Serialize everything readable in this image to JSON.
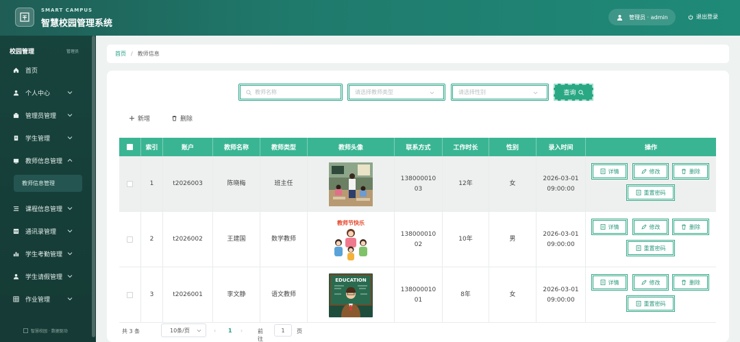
{
  "header": {
    "brand_en": "SMART CAMPUS",
    "brand_cn": "智慧校园管理系统",
    "user_label": "管理员 · admin",
    "logout_label": "退出登录"
  },
  "sidebar": {
    "title": "校园管理",
    "title_sub": "管理员",
    "items": [
      {
        "label": "首页",
        "icon": "home-icon"
      },
      {
        "label": "个人中心",
        "icon": "user-icon"
      },
      {
        "label": "管理员管理",
        "icon": "admin-icon"
      },
      {
        "label": "学生管理",
        "icon": "student-icon"
      },
      {
        "label": "教师信息管理",
        "icon": "teacher-icon"
      },
      {
        "label": "课程信息管理",
        "icon": "course-icon"
      },
      {
        "label": "通讯录管理",
        "icon": "contacts-icon"
      },
      {
        "label": "学生考勤管理",
        "icon": "chart-icon"
      },
      {
        "label": "学生请假管理",
        "icon": "leave-icon"
      },
      {
        "label": "作业管理",
        "icon": "grid-icon"
      }
    ],
    "active_sub": "教师信息管理",
    "footer": "智慧校园 · 数据驱动"
  },
  "breadcrumb": {
    "home": "首页",
    "sep": "/",
    "current": "教师信息"
  },
  "search": {
    "name_placeholder": "教师名称",
    "type_placeholder": "请选择教师类型",
    "gender_placeholder": "请选择性别",
    "query_label": "查询"
  },
  "actions": {
    "add_label": "新增",
    "delete_label": "删除"
  },
  "table": {
    "columns": [
      "索引",
      "账户",
      "教师名称",
      "教师类型",
      "教师头像",
      "联系方式",
      "工作时长",
      "性别",
      "录入时间",
      "操作"
    ],
    "rows": [
      {
        "index": "1",
        "account": "t2026003",
        "name": "陈晓梅",
        "type": "班主任",
        "avatar": "classroom-photo",
        "phone": "13800001003",
        "years": "12年",
        "gender": "女",
        "date": "2026-03-01",
        "time": "09:00:00"
      },
      {
        "index": "2",
        "account": "t2026002",
        "name": "王建国",
        "type": "数学教师",
        "avatar": "teachers-day-photo",
        "avatar_caption": "教师节快乐",
        "phone": "13800001002",
        "years": "10年",
        "gender": "男",
        "date": "2026-03-01",
        "time": "09:00:00"
      },
      {
        "index": "3",
        "account": "t2026001",
        "name": "李文静",
        "type": "语文教师",
        "avatar": "education-photo",
        "avatar_caption": "EDUCATION",
        "phone": "13800001001",
        "years": "8年",
        "gender": "女",
        "date": "2026-03-01",
        "time": "09:00:00"
      }
    ],
    "op_labels": {
      "detail": "详情",
      "edit": "修改",
      "delete": "删除",
      "reset": "重置密码"
    }
  },
  "pagination": {
    "total_text": "共 3 条",
    "page_size": "10条/页",
    "prev": "‹",
    "current_page": "1",
    "next": "›",
    "goto": "前往",
    "goto_value": "1",
    "unit": "页"
  },
  "colors": {
    "primary": "#2aa884",
    "header_start": "#1f5d55",
    "sidebar_bg": "#17433d",
    "table_header": "#3ab593"
  }
}
